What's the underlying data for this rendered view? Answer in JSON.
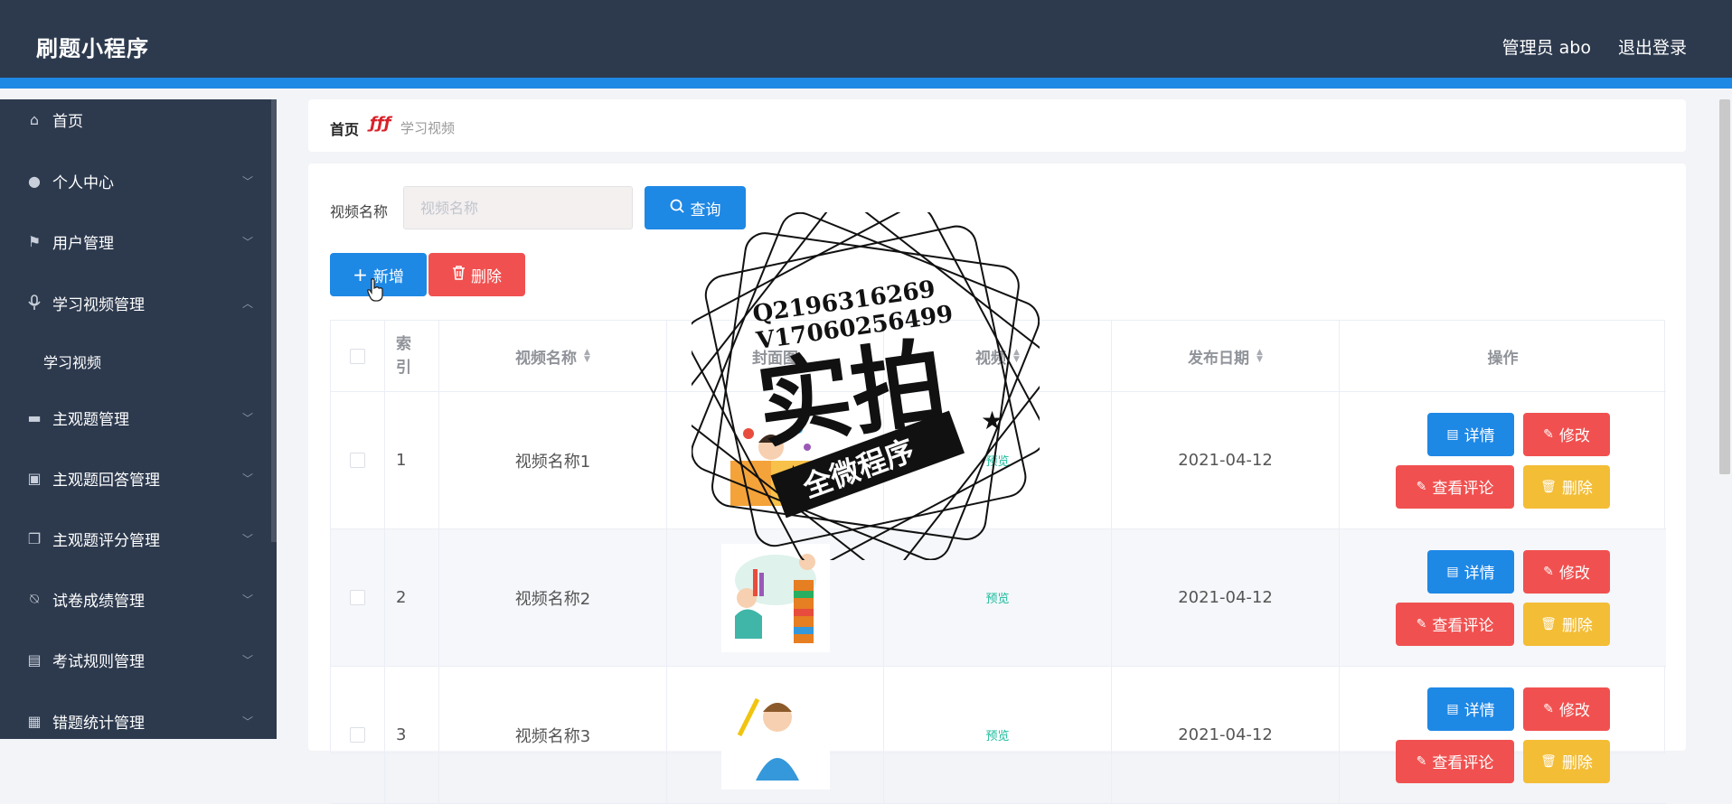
{
  "app": {
    "title": "刷题小程序",
    "user": "管理员 abo",
    "logout": "退出登录"
  },
  "sidebar": {
    "items": [
      {
        "label": "首页",
        "icon": "home-icon",
        "glyph": "⌂"
      },
      {
        "label": "个人中心",
        "icon": "person-icon",
        "glyph": "●"
      },
      {
        "label": "用户管理",
        "icon": "flag-icon",
        "glyph": "⚑"
      },
      {
        "label": "学习视频管理",
        "icon": "microphone-icon",
        "glyph": "🎙"
      },
      {
        "label": "主观题管理",
        "icon": "inbox-icon",
        "glyph": "▬"
      },
      {
        "label": "主观题回答管理",
        "icon": "briefcase-icon",
        "glyph": "▣"
      },
      {
        "label": "主观题评分管理",
        "icon": "copy-icon",
        "glyph": "❐"
      },
      {
        "label": "试卷成绩管理",
        "icon": "bell-off-icon",
        "glyph": "⍉"
      },
      {
        "label": "考试规则管理",
        "icon": "clipboard-icon",
        "glyph": "▤"
      },
      {
        "label": "错题统计管理",
        "icon": "grid-icon",
        "glyph": "▦"
      }
    ],
    "sub": "学习视频"
  },
  "breadcrumb": {
    "home": "首页",
    "sep": "ƒƒƒ",
    "current": "学习视频"
  },
  "search": {
    "label": "视频名称",
    "placeholder": "视频名称",
    "button": "查询"
  },
  "actions": {
    "add": "新增",
    "delete": "删除"
  },
  "table": {
    "headers": {
      "index": "索\n引",
      "name": "视频名称",
      "cover": "封面图",
      "video": "视频",
      "date": "发布日期",
      "ops": "操作"
    },
    "rows": [
      {
        "index": "1",
        "name": "视频名称1",
        "video": "预览",
        "date": "2021-04-12"
      },
      {
        "index": "2",
        "name": "视频名称2",
        "video": "预览",
        "date": "2021-04-12"
      },
      {
        "index": "3",
        "name": "视频名称3",
        "video": "预览",
        "date": "2021-04-12"
      }
    ],
    "op_labels": {
      "detail": "详情",
      "edit": "修改",
      "comment": "查看评论",
      "del": "删除"
    }
  },
  "watermark": {
    "line1": "Q2196316269",
    "line2": "V17060256499",
    "big": "实拍",
    "banner": "全微程序"
  },
  "colors": {
    "header": "#2d3a4e",
    "accent": "#1e88e5",
    "danger": "#f05150",
    "warning": "#f3bd36",
    "preview": "#1abc9c"
  }
}
